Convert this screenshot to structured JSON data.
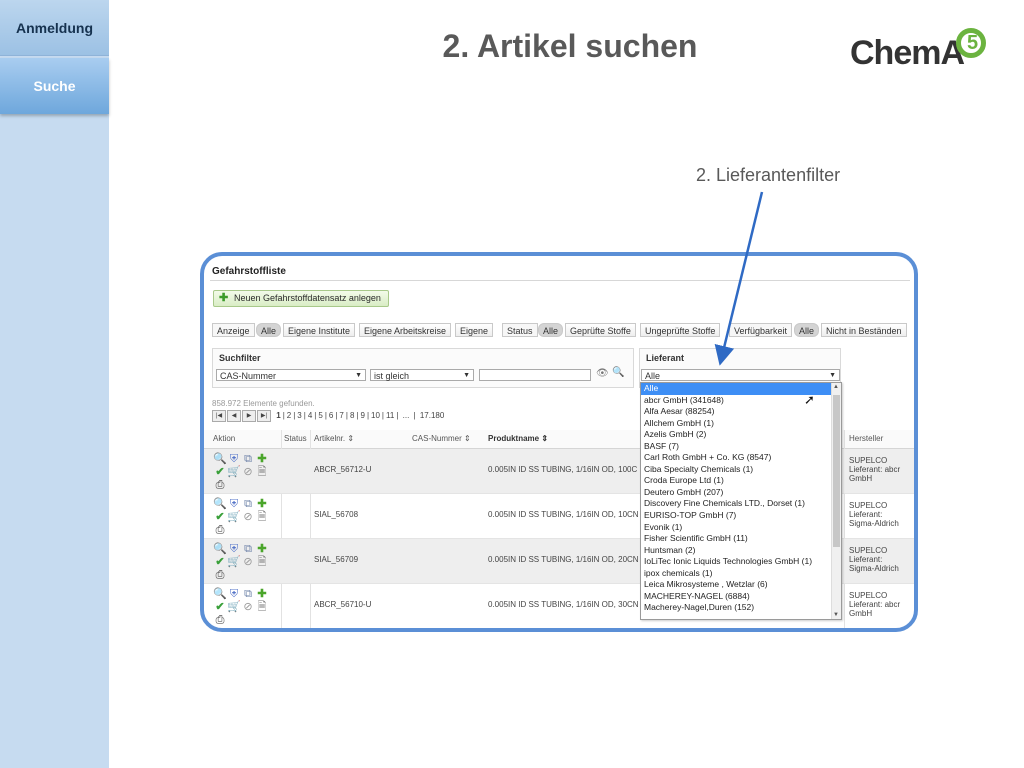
{
  "sidebar": {
    "tabs": [
      {
        "label": "Anmeldung"
      },
      {
        "label": "Suche"
      }
    ]
  },
  "slide": {
    "title": "2. Artikel suchen",
    "callout": "2. Lieferantenfilter",
    "logo": {
      "text": "ChemA",
      "number": "5"
    }
  },
  "app": {
    "panel_title": "Gefahrstoffliste",
    "new_button": "Neuen Gefahrstoffdatensatz anlegen",
    "anzeige": {
      "label": "Anzeige",
      "options": [
        "Alle",
        "Eigene Institute",
        "Eigene Arbeitskreise",
        "Eigene"
      ]
    },
    "status": {
      "label": "Status",
      "options": [
        "Alle",
        "Geprüfte Stoffe",
        "Ungeprüfte Stoffe"
      ]
    },
    "verfuegbarkeit": {
      "label": "Verfügbarkeit",
      "options": [
        "Alle",
        "Nicht in Beständen"
      ]
    },
    "suchfilter": {
      "title": "Suchfilter",
      "field": "CAS-Nummer",
      "operator": "ist gleich",
      "value": ""
    },
    "lieferant": {
      "title": "Lieferant",
      "selected": "Alle"
    },
    "found": "858.972 Elemente gefunden.",
    "pager": {
      "pages": [
        "1",
        "2",
        "3",
        "4",
        "5",
        "6",
        "7",
        "8",
        "9",
        "10",
        "11"
      ],
      "ellipsis": "...",
      "last": "17.180"
    },
    "columns": [
      "Aktion",
      "Status",
      "Artikelnr. ⇕",
      "CAS-Nummer ⇕",
      "Produktname ⇕",
      "Hersteller"
    ],
    "rows": [
      {
        "artikel": "ABCR_56712-U",
        "produkt": "0.005IN ID SS TUBING, 1/16IN OD, 100C",
        "hersteller": "SUPELCO",
        "lieferant": "Lieferant: abcr GmbH"
      },
      {
        "artikel": "SIAL_56708",
        "produkt": "0.005IN ID SS TUBING, 1/16IN OD, 10CN",
        "hersteller": "SUPELCO",
        "lieferant": "Lieferant: Sigma-Aldrich"
      },
      {
        "artikel": "SIAL_56709",
        "produkt": "0.005IN ID SS TUBING, 1/16IN OD, 20CN",
        "hersteller": "SUPELCO",
        "lieferant": "Lieferant: Sigma-Aldrich"
      },
      {
        "artikel": "ABCR_56710-U",
        "produkt": "0.005IN ID SS TUBING, 1/16IN OD, 30CN",
        "hersteller": "SUPELCO",
        "lieferant": "Lieferant: abcr GmbH"
      }
    ],
    "lieferant_options": [
      "Alle",
      "abcr GmbH (341648)",
      "Alfa Aesar (88254)",
      "Allchem GmbH (1)",
      "Azelis GmbH (2)",
      "BASF (7)",
      "Carl Roth GmbH + Co. KG (8547)",
      "Ciba Specialty Chemicals (1)",
      "Croda Europe Ltd (1)",
      "Deutero GmbH (207)",
      "Discovery Fine Chemicals LTD., Dorset (1)",
      "EURISO-TOP GmbH (7)",
      "Evonik (1)",
      "Fisher Scientific GmbH (11)",
      "Huntsman (2)",
      "IoLiTec Ionic Liquids Technologies GmbH (1)",
      "ipox chemicals (1)",
      "Leica Mikrosysteme , Wetzlar (6)",
      "MACHEREY-NAGEL (6884)",
      "Macherey-Nagel,Duren (152)"
    ]
  },
  "colors": {
    "sidebar": "#c6dbf0",
    "frame": "#5b8fd6",
    "selection": "#3d8ef5",
    "logo_green": "#6bb33f"
  }
}
